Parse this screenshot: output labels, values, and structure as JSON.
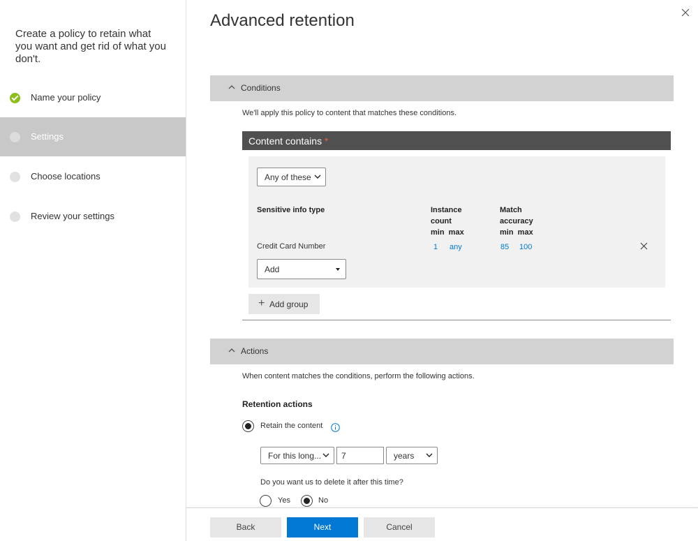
{
  "wizard": {
    "intro": "Create a policy to retain what you want and get rid of what you don't.",
    "steps": [
      {
        "label": "Name your policy",
        "state": "done"
      },
      {
        "label": "Settings",
        "state": "active"
      },
      {
        "label": "Choose locations",
        "state": "pending"
      },
      {
        "label": "Review your settings",
        "state": "pending"
      }
    ]
  },
  "page": {
    "title": "Advanced retention"
  },
  "conditions": {
    "header": "Conditions",
    "note": "We'll apply this policy to content that matches these conditions.",
    "content_contains": "Content contains",
    "required_mark": "*",
    "match_select": "Any of these",
    "columns": {
      "type": "Sensitive info type",
      "instance_count": "Instance count",
      "instance_minmax": "min  max",
      "match_accuracy": "Match accuracy",
      "accuracy_minmax": "min  max"
    },
    "rows": [
      {
        "type": "Credit Card Number",
        "instance_min": "1",
        "instance_max": "any",
        "accuracy_min": "85",
        "accuracy_max": "100"
      }
    ],
    "add_select": "Add",
    "add_group": "Add group"
  },
  "actions": {
    "header": "Actions",
    "note": "When content matches the conditions, perform the following actions.",
    "retention_title": "Retention actions",
    "retain_label": "Retain the content",
    "retain_checked": true,
    "period_select": "For this long...",
    "period_value": "7",
    "unit_select": "years",
    "delete_question": "Do you want us to delete it after this time?",
    "yes_label": "Yes",
    "no_label": "No",
    "delete_choice": "No"
  },
  "footer": {
    "back": "Back",
    "next": "Next",
    "cancel": "Cancel"
  },
  "colors": {
    "accent": "#0078d4",
    "done": "#8cbd18",
    "active_step": "#c8c8c8",
    "section_header": "#d2d2d2",
    "bar": "#505050"
  }
}
